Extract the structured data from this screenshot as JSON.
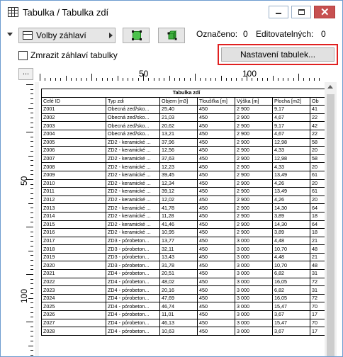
{
  "window": {
    "title": "Tabulka /  Tabulka zdí"
  },
  "toolbar": {
    "volby_label": "Volby záhlaví",
    "oznaceno_label": "Označeno:",
    "oznaceno_value": "0",
    "editovatelnych_label": "Editovatelných:",
    "editovatelnych_value": "0",
    "freeze_label": "Zmrazit záhlaví tabulky",
    "nastaveni_label": "Nastavení tabulek...",
    "corner_label": "..."
  },
  "ruler": {
    "h_labels": [
      "50",
      "100"
    ],
    "v_labels": [
      "50",
      "100"
    ]
  },
  "table": {
    "title": "Tabulka zdí",
    "headers": [
      "Celé ID",
      "Typ zdi",
      "Objem [m3]",
      "Tloušťka [m]",
      "Výška [m]",
      "Plocha [m2]",
      "Ob"
    ],
    "rows": [
      [
        "Z001",
        "Obecná zeď/sko...",
        "25,40",
        "450",
        "2 900",
        "9,17",
        "41"
      ],
      [
        "Z002",
        "Obecná zeď/sko...",
        "21,03",
        "450",
        "2 900",
        "4,67",
        "22"
      ],
      [
        "Z003",
        "Obecná zeď/sko...",
        "20,62",
        "450",
        "2 900",
        "9,17",
        "42"
      ],
      [
        "Z004",
        "Obecná zeď/sko...",
        "13,21",
        "450",
        "2 900",
        "4,67",
        "22"
      ],
      [
        "Z005",
        "ZD2 - keramické ...",
        "37,96",
        "450",
        "2 900",
        "12,98",
        "58"
      ],
      [
        "Z006",
        "ZD2 - keramické ...",
        "12,56",
        "450",
        "2 900",
        "4,33",
        "20"
      ],
      [
        "Z007",
        "ZD2 - keramické ...",
        "37,63",
        "450",
        "2 900",
        "12,98",
        "58"
      ],
      [
        "Z008",
        "ZD2 - keramické ...",
        "12,23",
        "450",
        "2 900",
        "4,33",
        "20"
      ],
      [
        "Z009",
        "ZD2 - keramické ...",
        "39,45",
        "450",
        "2 900",
        "13,49",
        "61"
      ],
      [
        "Z010",
        "ZD2 - keramické ...",
        "12,34",
        "450",
        "2 900",
        "4,26",
        "20"
      ],
      [
        "Z011",
        "ZD2 - keramické ...",
        "39,12",
        "450",
        "2 900",
        "13,49",
        "61"
      ],
      [
        "Z012",
        "ZD2 - keramické ...",
        "12,02",
        "450",
        "2 900",
        "4,26",
        "20"
      ],
      [
        "Z013",
        "ZD2 - keramické ...",
        "41,78",
        "450",
        "2 900",
        "14,30",
        "64"
      ],
      [
        "Z014",
        "ZD2 - keramické ...",
        "11,28",
        "450",
        "2 900",
        "3,89",
        "18"
      ],
      [
        "Z015",
        "ZD2 - keramické ...",
        "41,46",
        "450",
        "2 900",
        "14,30",
        "64"
      ],
      [
        "Z016",
        "ZD2 - keramické ...",
        "10,95",
        "450",
        "2 900",
        "3,89",
        "18"
      ],
      [
        "Z017",
        "ZD3 - pórobeton...",
        "13,77",
        "450",
        "3 000",
        "4,48",
        "21"
      ],
      [
        "Z018",
        "ZD3 - pórobeton...",
        "32,11",
        "450",
        "3 000",
        "10,70",
        "48"
      ],
      [
        "Z019",
        "ZD3 - pórobeton...",
        "13,43",
        "450",
        "3 000",
        "4,48",
        "21"
      ],
      [
        "Z020",
        "ZD3 - pórobeton...",
        "31,78",
        "450",
        "3 000",
        "10,70",
        "48"
      ],
      [
        "Z021",
        "ZD4 - pórobeton...",
        "20,51",
        "450",
        "3 000",
        "6,82",
        "31"
      ],
      [
        "Z022",
        "ZD4 - pórobeton...",
        "48,02",
        "450",
        "3 000",
        "16,05",
        "72"
      ],
      [
        "Z023",
        "ZD4 - pórobeton...",
        "20,16",
        "450",
        "3 000",
        "6,82",
        "31"
      ],
      [
        "Z024",
        "ZD4 - pórobeton...",
        "47,69",
        "450",
        "3 000",
        "16,05",
        "72"
      ],
      [
        "Z025",
        "ZD4 - pórobeton...",
        "46,74",
        "450",
        "3 000",
        "15,47",
        "70"
      ],
      [
        "Z026",
        "ZD4 - pórobeton...",
        "11,01",
        "450",
        "3 000",
        "3,67",
        "17"
      ],
      [
        "Z027",
        "ZD4 - pórobeton...",
        "46,13",
        "450",
        "3 000",
        "15,47",
        "70"
      ],
      [
        "Z028",
        "ZD4 - pórobeton...",
        "10,63",
        "450",
        "3 000",
        "3,67",
        "17"
      ]
    ]
  }
}
